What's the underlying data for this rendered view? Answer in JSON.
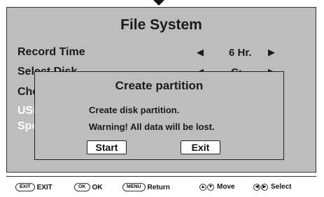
{
  "screen": {
    "title": "File System",
    "rows": [
      {
        "label": "Record Time",
        "value": "6 Hr."
      },
      {
        "label": "Select Disk",
        "value": "C:"
      },
      {
        "label": "Che"
      },
      {
        "label": "USB"
      },
      {
        "label": "Spec"
      }
    ]
  },
  "dialog": {
    "title": "Create partition",
    "line1": "Create disk partition.",
    "line2": "Warning! All data will be lost.",
    "start_label": "Start",
    "exit_label": "Exit"
  },
  "footer": {
    "exit_key": "EXIT",
    "exit_label": "EXIT",
    "ok_key": "OK",
    "ok_label": "OK",
    "menu_key": "MENU",
    "menu_label": "Return",
    "move_label": "Move",
    "select_label": "Select"
  },
  "colors": {
    "panel_bg": "#bdbdbd",
    "button_bg": "#ffffff",
    "text": "#1a1a1a",
    "highlight_text": "#ffffff"
  },
  "icons": [
    "down-arrow-icon",
    "left-arrow-icon",
    "right-arrow-icon",
    "up-down-arrows-icon",
    "left-right-arrows-icon"
  ]
}
